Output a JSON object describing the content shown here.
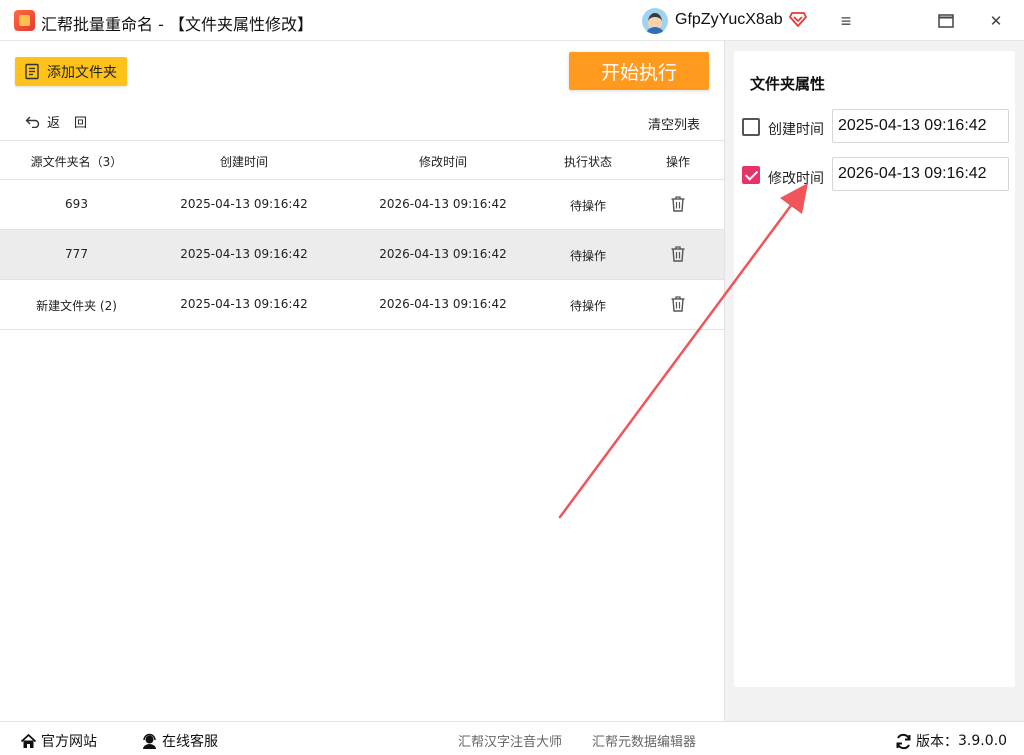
{
  "titlebar": {
    "title": "汇帮批量重命名 - 【文件夹属性修改】",
    "username": "GfpZyYucX8ab",
    "menu_glyph": "≡",
    "close_glyph": "✕"
  },
  "toolbar": {
    "add_folder_label": "添加文件夹",
    "start_label": "开始执行",
    "back_label": "返回",
    "clear_list_label": "清空列表"
  },
  "table": {
    "headers": [
      "源文件夹名（3）",
      "创建时间",
      "修改时间",
      "执行状态",
      "操作"
    ],
    "rows": [
      {
        "name": "693",
        "created": "2025-04-13 09:16:42",
        "modified": "2026-04-13 09:16:42",
        "status": "待操作"
      },
      {
        "name": "777",
        "created": "2025-04-13 09:16:42",
        "modified": "2026-04-13 09:16:42",
        "status": "待操作"
      },
      {
        "name": "新建文件夹 (2)",
        "created": "2025-04-13 09:16:42",
        "modified": "2026-04-13 09:16:42",
        "status": "待操作"
      }
    ]
  },
  "panel": {
    "title": "文件夹属性",
    "create_time": {
      "label": "创建时间",
      "checked": false,
      "value": "2025-04-13 09:16:42"
    },
    "modify_time": {
      "label": "修改时间",
      "checked": true,
      "value": "2026-04-13 09:16:42"
    }
  },
  "footer": {
    "website": "官方网站",
    "support": "在线客服",
    "pinyin_tool": "汇帮汉字注音大师",
    "metadata_tool": "汇帮元数据编辑器",
    "version_label": "版本：",
    "version": "3.9.0.0"
  },
  "colors": {
    "accent_yellow": "#ffc21a",
    "start_orange": "#ff9a1f",
    "checkbox_pink": "#e8336a",
    "arrow_red": "#f0555a"
  }
}
